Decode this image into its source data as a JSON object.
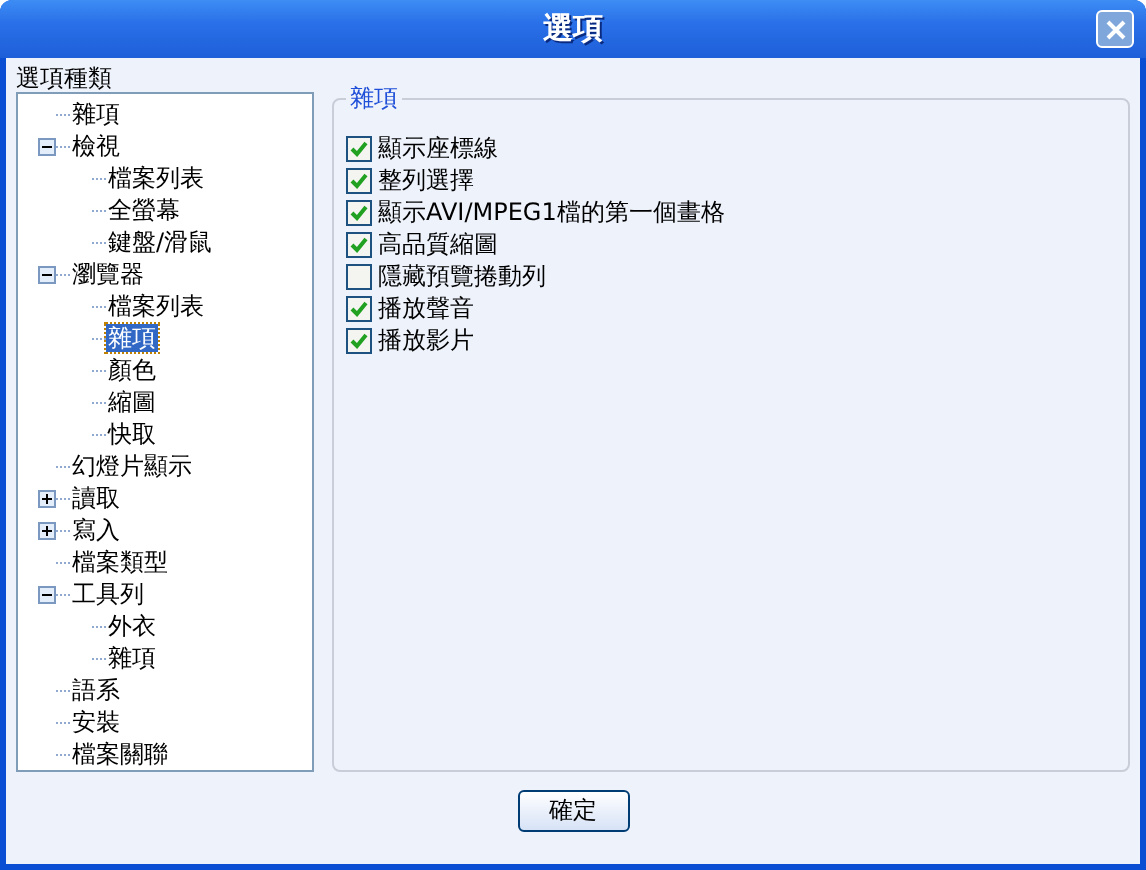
{
  "window": {
    "title": "選項"
  },
  "tree": {
    "label": "選項種類",
    "items": [
      {
        "label": "雜項",
        "selected": false
      },
      {
        "label": "檢視",
        "expanded": true,
        "selected": false,
        "children": [
          {
            "label": "檔案列表",
            "selected": false
          },
          {
            "label": "全螢幕",
            "selected": false
          },
          {
            "label": "鍵盤/滑鼠",
            "selected": false
          }
        ]
      },
      {
        "label": "瀏覽器",
        "expanded": true,
        "selected": false,
        "children": [
          {
            "label": "檔案列表",
            "selected": false
          },
          {
            "label": "雜項",
            "selected": true
          },
          {
            "label": "顏色",
            "selected": false
          },
          {
            "label": "縮圖",
            "selected": false
          },
          {
            "label": "快取",
            "selected": false
          }
        ]
      },
      {
        "label": "幻燈片顯示",
        "selected": false
      },
      {
        "label": "讀取",
        "expanded": false,
        "selected": false
      },
      {
        "label": "寫入",
        "expanded": false,
        "selected": false
      },
      {
        "label": "檔案類型",
        "selected": false
      },
      {
        "label": "工具列",
        "expanded": true,
        "selected": false,
        "children": [
          {
            "label": "外衣",
            "selected": false
          },
          {
            "label": "雜項",
            "selected": false
          }
        ]
      },
      {
        "label": "語系",
        "selected": false
      },
      {
        "label": "安裝",
        "selected": false
      },
      {
        "label": "檔案關聯",
        "selected": false
      }
    ]
  },
  "group": {
    "title": "雜項",
    "options": [
      {
        "label": "顯示座標線",
        "checked": true
      },
      {
        "label": "整列選擇",
        "checked": true
      },
      {
        "label": "顯示AVI/MPEG1檔的第一個畫格",
        "checked": true
      },
      {
        "label": "高品質縮圖",
        "checked": true
      },
      {
        "label": "隱藏預覽捲動列",
        "checked": false
      },
      {
        "label": "播放聲音",
        "checked": true
      },
      {
        "label": "播放影片",
        "checked": true
      }
    ]
  },
  "buttons": [
    {
      "label": "確定"
    }
  ]
}
